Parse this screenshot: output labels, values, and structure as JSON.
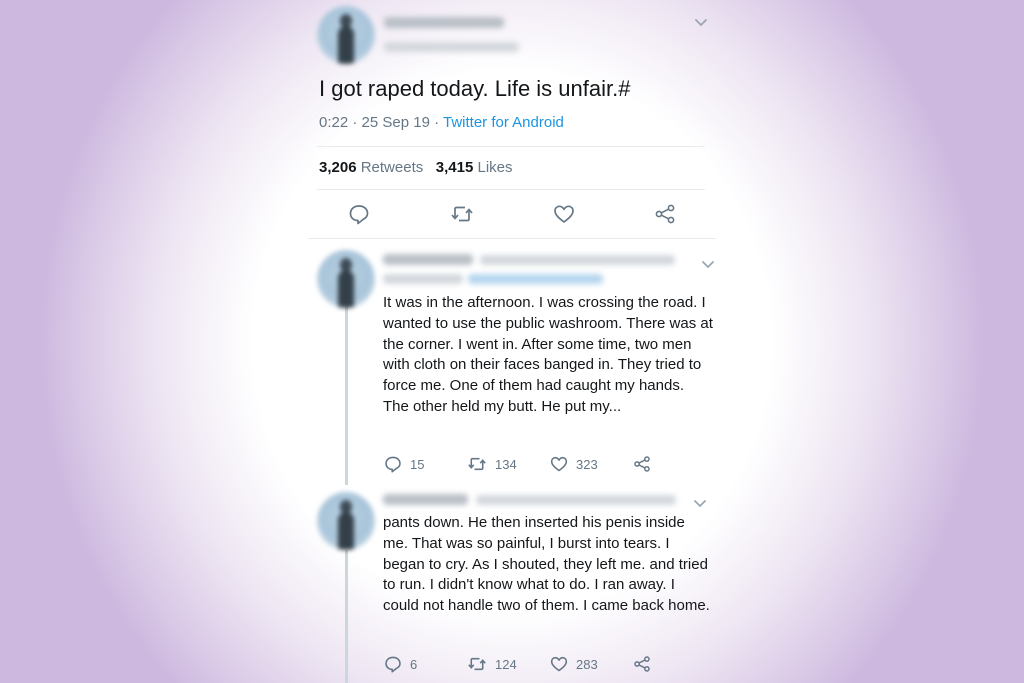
{
  "main_tweet": {
    "text": "I got raped today. Life is unfair.#",
    "time": "0:22 · 25 Sep 19 · ",
    "source": "Twitter for Android",
    "retweets_count": "3,206",
    "retweets_label": "Retweets",
    "likes_count": "3,415",
    "likes_label": "Likes"
  },
  "replies": [
    {
      "text": "It was in the afternoon. I was crossing the road. I wanted to use the public washroom. There was at the corner. I went in. After some time, two men with cloth on their faces banged in. They tried to force me. One of them had caught my hands. The other held my butt. He put my...",
      "reply_count": "15",
      "retweet_count": "134",
      "like_count": "323"
    },
    {
      "text": "pants down. He then inserted his penis inside me. That was so painful, I burst into tears. I began to cry. As I shouted, they left me. and tried to run. I didn't know what to do. I ran away. I could not handle two of them. I came back home.",
      "reply_count": "6",
      "retweet_count": "124",
      "like_count": "283"
    }
  ],
  "icons": [
    "chevron-down-icon",
    "reply-icon",
    "retweet-icon",
    "like-icon",
    "share-icon"
  ],
  "colors": {
    "link": "#1b95e0",
    "secondary": "#657786",
    "background_edge": "#cdb9df"
  }
}
